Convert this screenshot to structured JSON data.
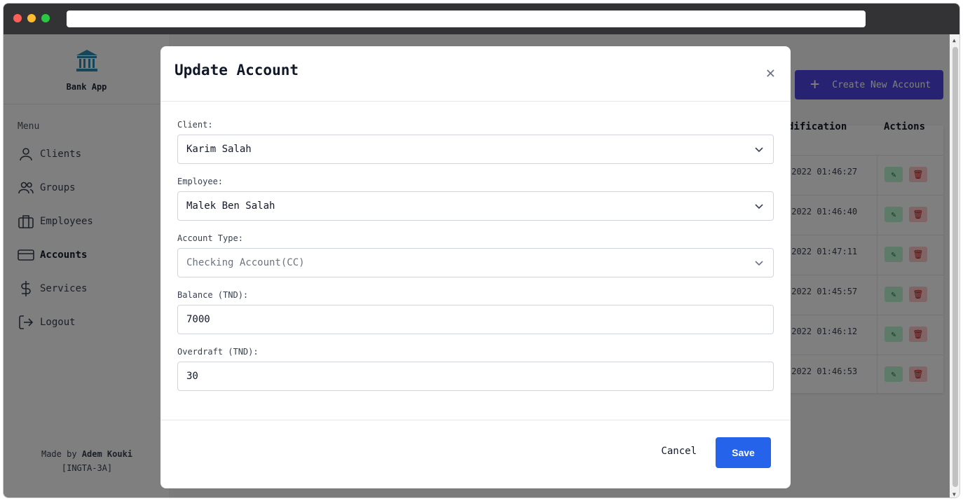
{
  "app": {
    "brand_name": "Bank App",
    "menu_label": "Menu",
    "nav": [
      {
        "label": "Clients",
        "icon": "user-icon"
      },
      {
        "label": "Groups",
        "icon": "users-icon"
      },
      {
        "label": "Employees",
        "icon": "briefcase-icon"
      },
      {
        "label": "Accounts",
        "icon": "credit-card-icon",
        "active": true
      },
      {
        "label": "Services",
        "icon": "dollar-icon"
      },
      {
        "label": "Logout",
        "icon": "logout-icon"
      }
    ],
    "credit_prefix": "Made by",
    "credit_name": "Adem Kouki",
    "credit_class": "[INGTA-3A]"
  },
  "main": {
    "create_button_label": "Create New Account",
    "table": {
      "col_modification": "dification",
      "col_actions": "Actions",
      "rows": [
        {
          "date": "-2022 01:46:27"
        },
        {
          "date": "-2022 01:46:40"
        },
        {
          "date": "-2022 01:47:11"
        },
        {
          "date": "-2022 01:45:57"
        },
        {
          "date": "-2022 01:46:12"
        },
        {
          "date": "-2022 01:46:53"
        }
      ]
    }
  },
  "modal": {
    "title": "Update Account",
    "client_label": "Client:",
    "client_value": "Karim Salah",
    "employee_label": "Employee:",
    "employee_value": "Malek Ben Salah",
    "account_type_label": "Account Type:",
    "account_type_value": "Checking Account(CC)",
    "balance_label": "Balance (TND):",
    "balance_value": "7000",
    "overdraft_label": "Overdraft (TND):",
    "overdraft_value": "30",
    "cancel_label": "Cancel",
    "save_label": "Save"
  },
  "colors": {
    "primary": "#2563eb",
    "create_button": "#4f46e5",
    "edit_button": "#bbf7d0",
    "delete_button": "#fecaca"
  }
}
